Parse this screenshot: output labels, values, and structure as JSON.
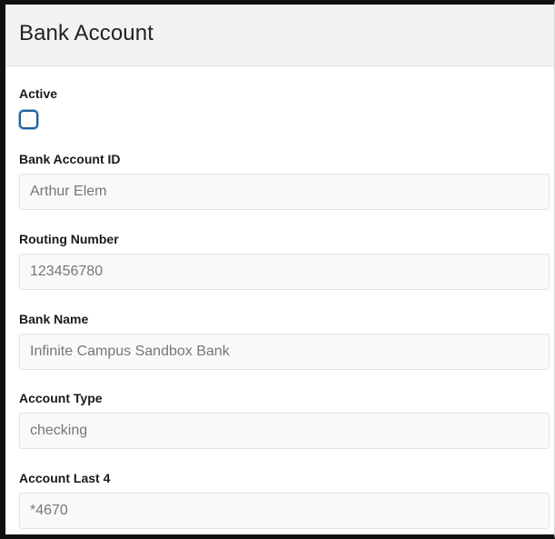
{
  "header": {
    "title": "Bank Account"
  },
  "form": {
    "active": {
      "label": "Active",
      "checked": false
    },
    "fields": [
      {
        "label": "Bank Account ID",
        "value": "Arthur Elem"
      },
      {
        "label": "Routing Number",
        "value": "123456780"
      },
      {
        "label": "Bank Name",
        "value": "Infinite Campus Sandbox Bank"
      },
      {
        "label": "Account Type",
        "value": "checking"
      },
      {
        "label": "Account Last 4",
        "value": "*4670"
      }
    ]
  },
  "colors": {
    "checkbox_border": "#1f5f99",
    "header_background": "#f2f2f2",
    "field_background": "#f9f9f9",
    "field_text": "#777777"
  }
}
